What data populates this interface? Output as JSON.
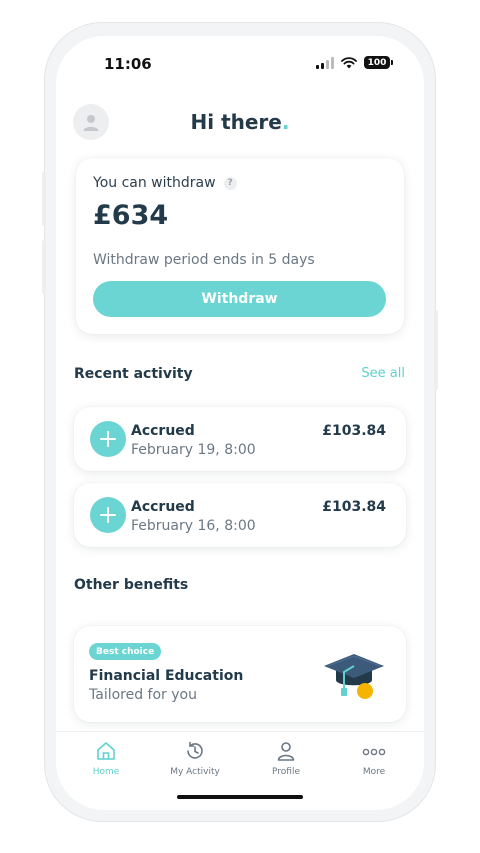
{
  "status_bar": {
    "time": "11:06",
    "battery": "100"
  },
  "header": {
    "greeting": "Hi there",
    "greeting_dot": "."
  },
  "withdraw_card": {
    "label": "You can withdraw",
    "help_icon_glyph": "?",
    "amount": "£634",
    "period_text": "Withdraw period ends in 5 days",
    "button_label": "Withdraw"
  },
  "recent_activity": {
    "title": "Recent activity",
    "see_all_label": "See all",
    "items": [
      {
        "title": "Accrued",
        "date": "February 19, 8:00",
        "amount": "£103.84"
      },
      {
        "title": "Accrued",
        "date": "February 16, 8:00",
        "amount": "£103.84"
      }
    ]
  },
  "other_benefits": {
    "title": "Other benefits",
    "card": {
      "badge": "Best choice",
      "title": "Financial Education",
      "subtitle": "Tailored for you"
    }
  },
  "tab_bar": {
    "tabs": [
      {
        "label": "Home",
        "icon": "home-icon",
        "active": true
      },
      {
        "label": "My Activity",
        "icon": "history-icon",
        "active": false
      },
      {
        "label": "Profile",
        "icon": "person-icon",
        "active": false
      },
      {
        "label": "More",
        "icon": "more-icon",
        "active": false
      }
    ]
  },
  "colors": {
    "accent": "#6ad5d3",
    "text_dark": "#233a4a",
    "text_muted": "#6b7884"
  }
}
